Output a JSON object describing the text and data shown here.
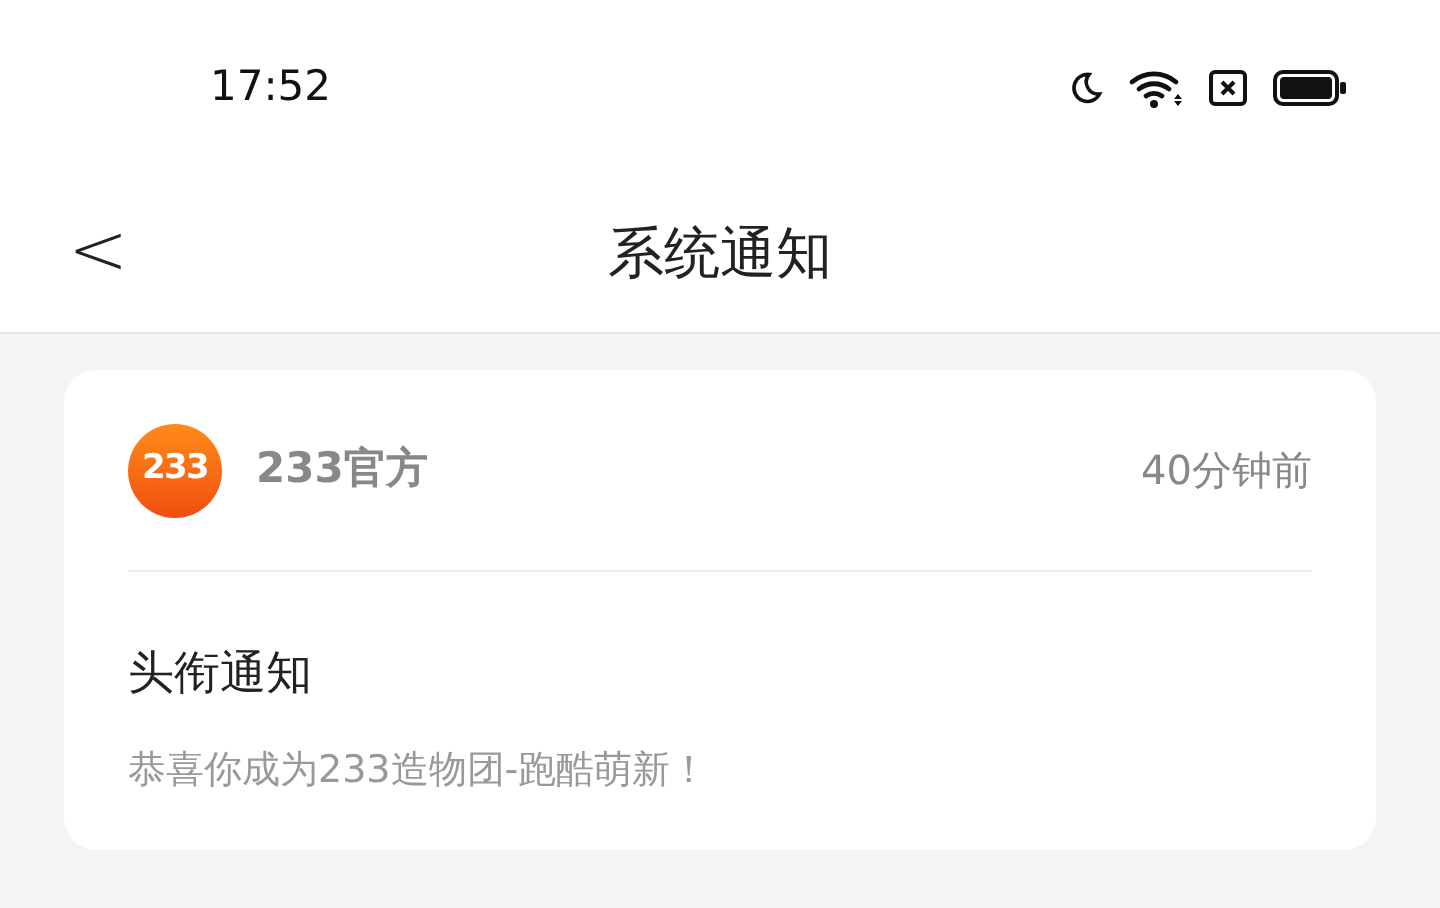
{
  "status_bar": {
    "time": "17:52"
  },
  "header": {
    "back": "<",
    "title": "系统通知"
  },
  "notification": {
    "logo_text": "233",
    "sender": "233官方",
    "time": "40分钟前",
    "title": "头衔通知",
    "message": "恭喜你成为233造物团-跑酷萌新！"
  }
}
